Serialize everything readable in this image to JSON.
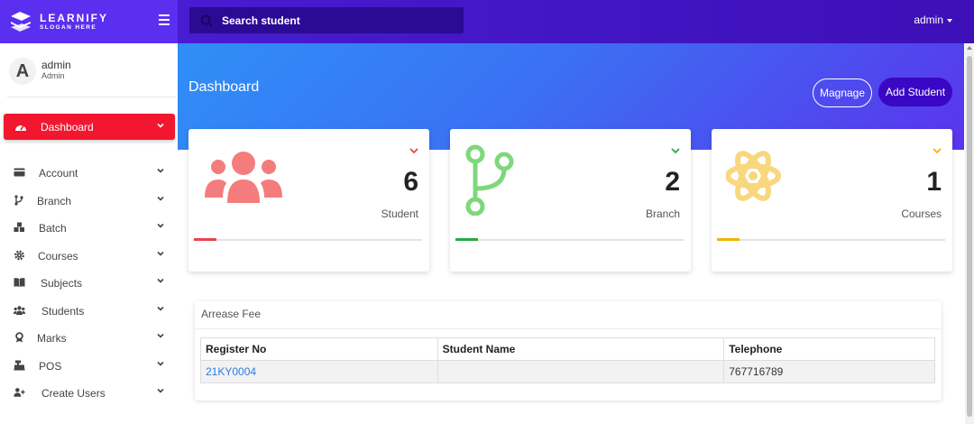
{
  "brand": {
    "name": "LEARNIFY",
    "slogan": "SLOGAN HERE"
  },
  "search": {
    "placeholder": "Search student"
  },
  "topbar": {
    "user": "admin"
  },
  "profile": {
    "initial": "A",
    "name": "admin",
    "role": "Admin"
  },
  "sidebar": {
    "active": {
      "label": "Dashboard",
      "icon": "gauge-icon"
    },
    "items": [
      {
        "label": "Account",
        "icon": "card-icon"
      },
      {
        "label": "Branch",
        "icon": "branch-icon"
      },
      {
        "label": "Batch",
        "icon": "cubes-icon"
      },
      {
        "label": "Courses",
        "icon": "cog-icon"
      },
      {
        "label": "Subjects",
        "icon": "book-icon"
      },
      {
        "label": "Students",
        "icon": "users-icon"
      },
      {
        "label": "Marks",
        "icon": "award-icon"
      },
      {
        "label": "POS",
        "icon": "cash-register-icon"
      },
      {
        "label": "Create Users",
        "icon": "user-plus-icon"
      }
    ]
  },
  "dashboard": {
    "title": "Dashboard",
    "manage_label": "Magnage",
    "add_student_label": "Add Student",
    "cards": [
      {
        "value": "6",
        "label": "Student",
        "color": "#f47c7c",
        "accent": "#e8434f",
        "progress": 0.1
      },
      {
        "value": "2",
        "label": "Branch",
        "color": "#7dd87b",
        "accent": "#29a846",
        "progress": 0.1
      },
      {
        "value": "1",
        "label": "Courses",
        "color": "#f8d77e",
        "accent": "#f0b400",
        "progress": 0.1
      }
    ]
  },
  "arrears": {
    "title": "Arrease Fee",
    "columns": [
      "Register No",
      "Student Name",
      "Telephone"
    ],
    "rows": [
      {
        "register_no": "21KY0004",
        "student_name": "",
        "telephone": "767716789"
      }
    ]
  }
}
